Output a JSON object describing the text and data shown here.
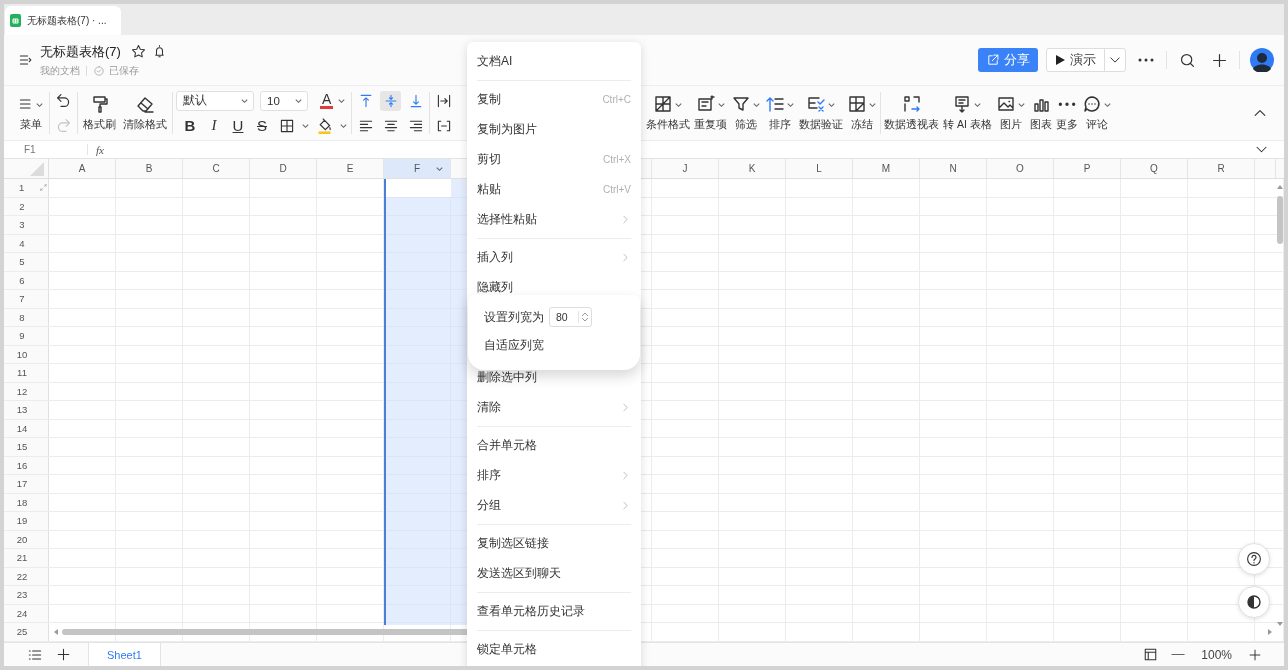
{
  "browser_tab": {
    "title": "无标题表格(7) · ..."
  },
  "document": {
    "title": "无标题表格(7)",
    "location": "我的文档",
    "save_status": "已保存"
  },
  "header_actions": {
    "share": "分享",
    "present": "演示"
  },
  "toolbar": {
    "menu": "菜单",
    "undo_disabled": false,
    "redo_disabled": true,
    "format_painter": "格式刷",
    "clear_format": "清除格式",
    "font": "默认",
    "font_size": "10",
    "font_color": "A",
    "text_styles": [
      {
        "kind": "bold",
        "glyph": "B"
      },
      {
        "kind": "italic",
        "glyph": "I"
      },
      {
        "kind": "underline",
        "glyph": "U"
      },
      {
        "kind": "strikethrough",
        "glyph": "S"
      }
    ],
    "vertical_align": [
      {
        "kind": "top",
        "selected": false
      },
      {
        "kind": "middle",
        "selected": true
      },
      {
        "kind": "bottom",
        "selected": false
      }
    ],
    "tools": [
      {
        "kind": "conditional",
        "label": "条件格式",
        "dropdown": true
      },
      {
        "kind": "duplicate",
        "label": "重复项",
        "dropdown": true
      },
      {
        "kind": "filter",
        "label": "筛选",
        "dropdown": true
      },
      {
        "kind": "sort",
        "label": "排序",
        "dropdown": true
      },
      {
        "kind": "validation",
        "label": "数据验证",
        "dropdown": true
      },
      {
        "kind": "freeze",
        "label": "冻结",
        "dropdown": true
      },
      {
        "kind": "separator"
      },
      {
        "kind": "pivot",
        "label": "数据透视表",
        "dropdown": false
      },
      {
        "kind": "to_ai",
        "label": "转 AI 表格",
        "dropdown": true
      },
      {
        "kind": "image",
        "label": "图片",
        "dropdown": true
      },
      {
        "kind": "chart",
        "label": "图表",
        "dropdown": false
      },
      {
        "kind": "more",
        "label": "更多",
        "dropdown": false
      },
      {
        "kind": "comment",
        "label": "评论",
        "dropdown": true
      }
    ]
  },
  "formula_bar": {
    "cell": "F1",
    "function_label": "fx"
  },
  "sheet": {
    "columns": [
      {
        "label": "A",
        "selected": false
      },
      {
        "label": "B",
        "selected": false
      },
      {
        "label": "C",
        "selected": false
      },
      {
        "label": "D",
        "selected": false
      },
      {
        "label": "E",
        "selected": false
      },
      {
        "label": "F",
        "selected": true
      },
      {
        "label": "J",
        "selected": false
      },
      {
        "label": "K",
        "selected": false
      },
      {
        "label": "L",
        "selected": false
      },
      {
        "label": "M",
        "selected": false
      },
      {
        "label": "N",
        "selected": false
      },
      {
        "label": "O",
        "selected": false
      },
      {
        "label": "P",
        "selected": false
      },
      {
        "label": "Q",
        "selected": false
      },
      {
        "label": "R",
        "selected": false
      }
    ],
    "rows": [
      "1",
      "2",
      "3",
      "4",
      "5",
      "6",
      "7",
      "8",
      "9",
      "10",
      "11",
      "12",
      "13",
      "14",
      "15",
      "16",
      "17",
      "18",
      "19",
      "20",
      "21",
      "22",
      "23",
      "24",
      "25"
    ]
  },
  "context_menu": {
    "items": [
      {
        "kind": "item",
        "label": "文档AI",
        "has_submenu": false
      },
      {
        "kind": "separator"
      },
      {
        "kind": "item",
        "label": "复制",
        "shortcut": "Ctrl+C",
        "has_submenu": false
      },
      {
        "kind": "item",
        "label": "复制为图片",
        "has_submenu": false
      },
      {
        "kind": "item",
        "label": "剪切",
        "shortcut": "Ctrl+X",
        "has_submenu": false
      },
      {
        "kind": "item",
        "label": "粘贴",
        "shortcut": "Ctrl+V",
        "has_submenu": false
      },
      {
        "kind": "item",
        "label": "选择性粘贴",
        "has_submenu": true
      },
      {
        "kind": "separator"
      },
      {
        "kind": "item",
        "label": "插入列",
        "has_submenu": true
      },
      {
        "kind": "item",
        "label": "隐藏列",
        "has_submenu": false
      },
      {
        "kind": "panel",
        "width_label": "设置列宽为",
        "width_value": "80",
        "autofit_label": "自适应列宽"
      },
      {
        "kind": "item",
        "label": "删除选中列",
        "has_submenu": false
      },
      {
        "kind": "item",
        "label": "清除",
        "has_submenu": true
      },
      {
        "kind": "separator"
      },
      {
        "kind": "item",
        "label": "合并单元格",
        "has_submenu": false
      },
      {
        "kind": "item",
        "label": "排序",
        "has_submenu": true
      },
      {
        "kind": "item",
        "label": "分组",
        "has_submenu": true
      },
      {
        "kind": "separator"
      },
      {
        "kind": "item",
        "label": "复制选区链接",
        "has_submenu": false
      },
      {
        "kind": "item",
        "label": "发送选区到聊天",
        "has_submenu": false
      },
      {
        "kind": "separator"
      },
      {
        "kind": "item",
        "label": "查看单元格历史记录",
        "has_submenu": false
      },
      {
        "kind": "separator"
      },
      {
        "kind": "item",
        "label": "锁定单元格",
        "has_submenu": false
      }
    ]
  },
  "sheet_tabs": [
    {
      "name": "Sheet1",
      "selected": true
    }
  ],
  "zoom": "100%"
}
